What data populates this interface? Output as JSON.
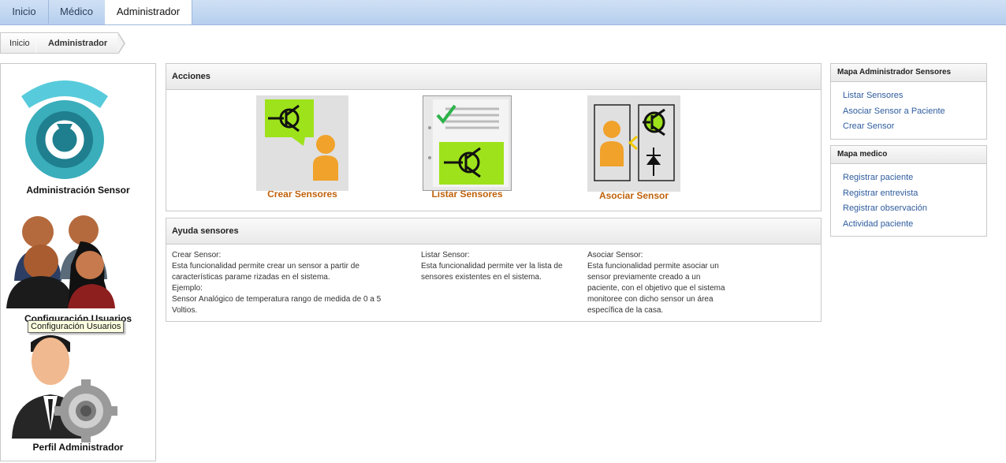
{
  "tabs": [
    {
      "label": "Inicio"
    },
    {
      "label": "Médico"
    },
    {
      "label": "Administrador"
    }
  ],
  "breadcrumb": [
    "Inicio",
    "Administrador"
  ],
  "left_panel": {
    "items": [
      {
        "label": "Administración Sensor"
      },
      {
        "label": "Configuración Usuarios"
      },
      {
        "label": "Perfil Administrador"
      }
    ],
    "tooltip": "Configuración Usuarios"
  },
  "acciones": {
    "title": "Acciones",
    "items": [
      {
        "label": "Crear Sensores"
      },
      {
        "label": "Listar Sensores"
      },
      {
        "label": "Asociar Sensor"
      }
    ]
  },
  "ayuda": {
    "title": "Ayuda sensores",
    "columns": [
      {
        "heading": "Crear Sensor:",
        "lines": [
          "Esta funcionalidad permite crear un sensor a partir de",
          "características parame rizadas en el sistema.",
          "Ejemplo:",
          "Sensor Analógico de temperatura rango de medida de 0 a 5",
          "Voltios."
        ]
      },
      {
        "heading": "Listar Sensor:",
        "lines": [
          "Esta funcionalidad permite ver la lista de",
          "sensores existentes en el sistema."
        ]
      },
      {
        "heading": "Asociar Sensor:",
        "lines": [
          "Esta funcionalidad permite asociar un",
          "sensor previamente creado a un",
          "paciente, con el objetivo que el sistema",
          "monitoree con dicho sensor un área",
          "específica de la casa."
        ]
      }
    ]
  },
  "sidebar": {
    "sensores": {
      "title": "Mapa Administrador Sensores",
      "links": [
        "Listar Sensores",
        "Asociar Sensor a Paciente",
        "Crear Sensor"
      ]
    },
    "medico": {
      "title": "Mapa medico",
      "links": [
        "Registrar paciente",
        "Registrar entrevista",
        "Registrar observación",
        "Actividad paciente"
      ]
    }
  },
  "colors": {
    "link": "#2f5c9e",
    "action_label": "#c0620b",
    "tab_bar": "#b6cfee",
    "icon_green": "#9ee21b",
    "icon_orange": "#f0a22b",
    "icon_teal": "#3aaebb"
  }
}
